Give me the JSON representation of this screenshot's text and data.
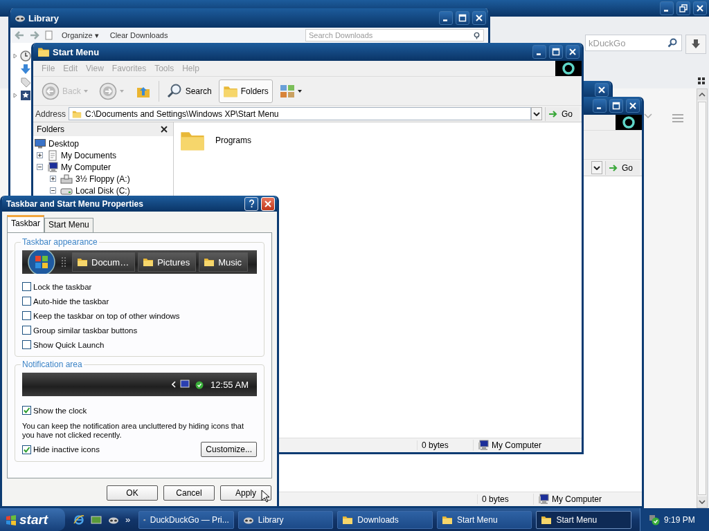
{
  "browser_window": {
    "search": {
      "placeholder": "kDuckGo"
    }
  },
  "library_window": {
    "title": "Library",
    "toolbar": [
      {
        "label": "Organize ▾"
      },
      {
        "label": "Clear Downloads"
      }
    ],
    "search": {
      "placeholder": "Search Downloads"
    }
  },
  "back_explorer_window": {
    "go": "Go",
    "status": {
      "size": "0 bytes",
      "location": "My Computer"
    }
  },
  "explorer_window": {
    "title": "Start Menu",
    "menu": [
      {
        "label": "File",
        "disabled": true
      },
      {
        "label": "Edit",
        "disabled": true
      },
      {
        "label": "View",
        "disabled": true
      },
      {
        "label": "Favorites",
        "disabled": true
      },
      {
        "label": "Tools",
        "disabled": true
      },
      {
        "label": "Help",
        "disabled": true
      }
    ],
    "toolbar": [
      {
        "kind": "back",
        "label": "Back",
        "disabled": true,
        "pressed": false
      },
      {
        "kind": "forward",
        "disabled": true,
        "pressed": false
      },
      {
        "kind": "up",
        "disabled": false,
        "pressed": false
      },
      {
        "kind": "search",
        "label": "Search",
        "disabled": false,
        "pressed": false
      },
      {
        "kind": "folders",
        "label": "Folders",
        "disabled": false,
        "pressed": true
      },
      {
        "kind": "views",
        "disabled": false,
        "pressed": false
      }
    ],
    "address": {
      "label": "Address",
      "value": "C:\\Documents and Settings\\Windows XP\\Start Menu",
      "go": "Go"
    },
    "folders": {
      "title": "Folders",
      "tree": [
        {
          "label": "Desktop",
          "kind": "desktop",
          "children": [
            {
              "label": "My Documents",
              "kind": "documents",
              "expanded": false
            },
            {
              "label": "My Computer",
              "kind": "computer",
              "expanded": true,
              "children": [
                {
                  "label": "3½ Floppy (A:)",
                  "kind": "floppy",
                  "expanded": false
                },
                {
                  "label": "Local Disk (C:)",
                  "kind": "disk",
                  "expanded": true
                }
              ]
            }
          ]
        }
      ]
    },
    "files": [
      {
        "name": "Programs"
      }
    ],
    "status": {
      "size": "0 bytes",
      "location": "My Computer"
    }
  },
  "dialog": {
    "title": "Taskbar and Start Menu Properties",
    "tabs": [
      {
        "label": "Taskbar",
        "selected": true
      },
      {
        "label": "Start Menu",
        "selected": false
      }
    ],
    "appearance": {
      "title": "Taskbar appearance",
      "preview_buttons": [
        "Docum…",
        "Pictures",
        "Music"
      ],
      "options": [
        {
          "label": "Lock the taskbar",
          "checked": false
        },
        {
          "label": "Auto-hide the taskbar",
          "checked": false
        },
        {
          "label": "Keep the taskbar on top of other windows",
          "checked": false
        },
        {
          "label": "Group similar taskbar buttons",
          "checked": false
        },
        {
          "label": "Show Quick Launch",
          "checked": false
        }
      ]
    },
    "notification": {
      "title": "Notification area",
      "preview_time": "12:55 AM",
      "clock_option": {
        "label": "Show the clock",
        "checked": true
      },
      "note": "You can keep the notification area uncluttered by hiding icons that you have not clicked recently.",
      "hide_option": {
        "label": "Hide inactive icons",
        "checked": true
      },
      "customize": "Customize..."
    },
    "buttons": [
      {
        "label": "OK"
      },
      {
        "label": "Cancel"
      },
      {
        "label": "Apply"
      }
    ]
  },
  "taskbar": {
    "start": "start",
    "more": "»",
    "tasks": [
      {
        "label": "DuckDuckGo — Pri...",
        "kind": "browser",
        "selected": false
      },
      {
        "label": "Library",
        "kind": "browser",
        "selected": false
      },
      {
        "label": "Downloads",
        "kind": "folder",
        "selected": false
      },
      {
        "label": "Start Menu",
        "kind": "folder",
        "selected": false
      },
      {
        "label": "Start Menu",
        "kind": "folder",
        "selected": true
      }
    ],
    "clock": "9:19 PM"
  }
}
